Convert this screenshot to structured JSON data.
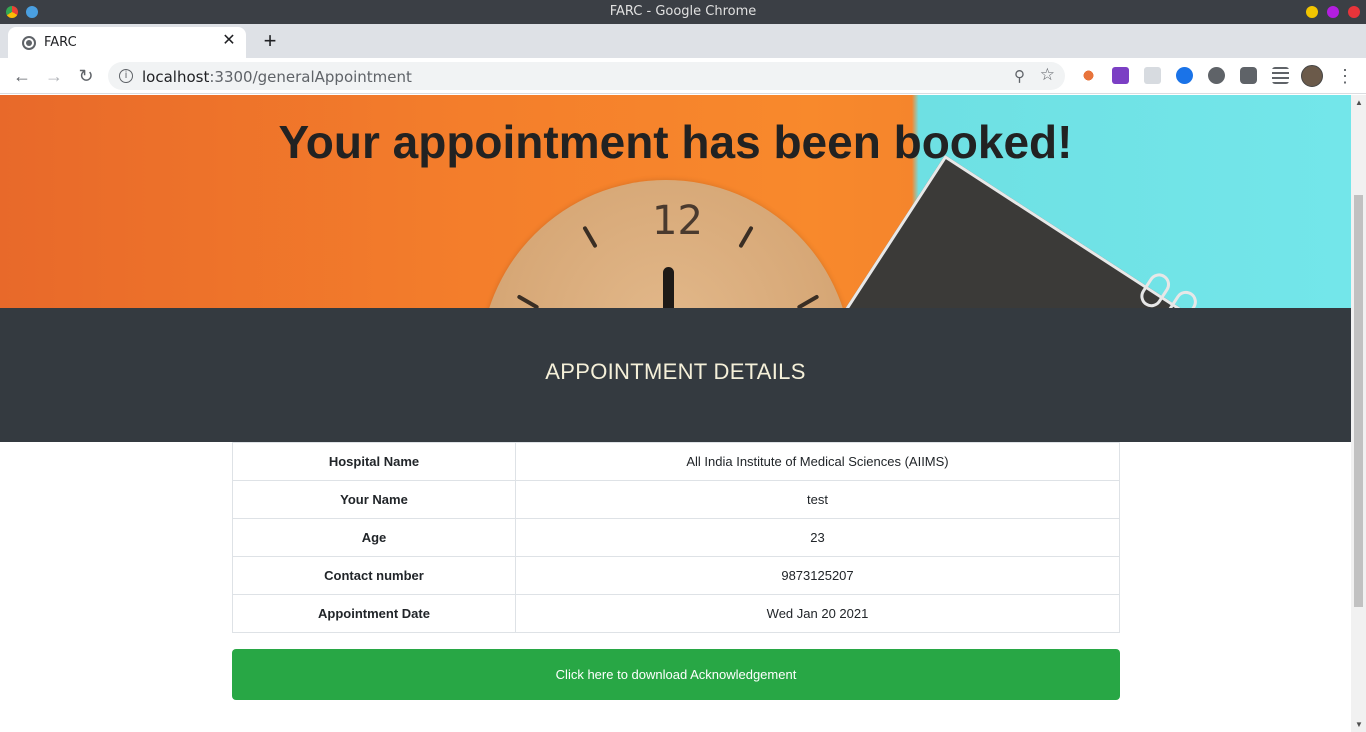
{
  "window": {
    "title": "FARC - Google Chrome"
  },
  "tab": {
    "title": "FARC",
    "close": "✕",
    "new_tab": "+"
  },
  "toolbar": {
    "url_host": "localhost",
    "url_path": ":3300/generalAppointment"
  },
  "hero": {
    "title": "Your appointment has been booked!",
    "clock_number": "12"
  },
  "section": {
    "heading": "APPOINTMENT DETAILS"
  },
  "details": [
    {
      "label": "Hospital Name",
      "value": "All India Institute of Medical Sciences (AIIMS)"
    },
    {
      "label": "Your Name",
      "value": "test"
    },
    {
      "label": "Age",
      "value": "23"
    },
    {
      "label": "Contact number",
      "value": "9873125207"
    },
    {
      "label": "Appointment Date",
      "value": "Wed Jan 20 2021"
    }
  ],
  "actions": {
    "download_label": "Click here to download Acknowledgement"
  },
  "colors": {
    "success": "#28a745",
    "band": "#343a40",
    "heading": "#f5f0d9"
  }
}
